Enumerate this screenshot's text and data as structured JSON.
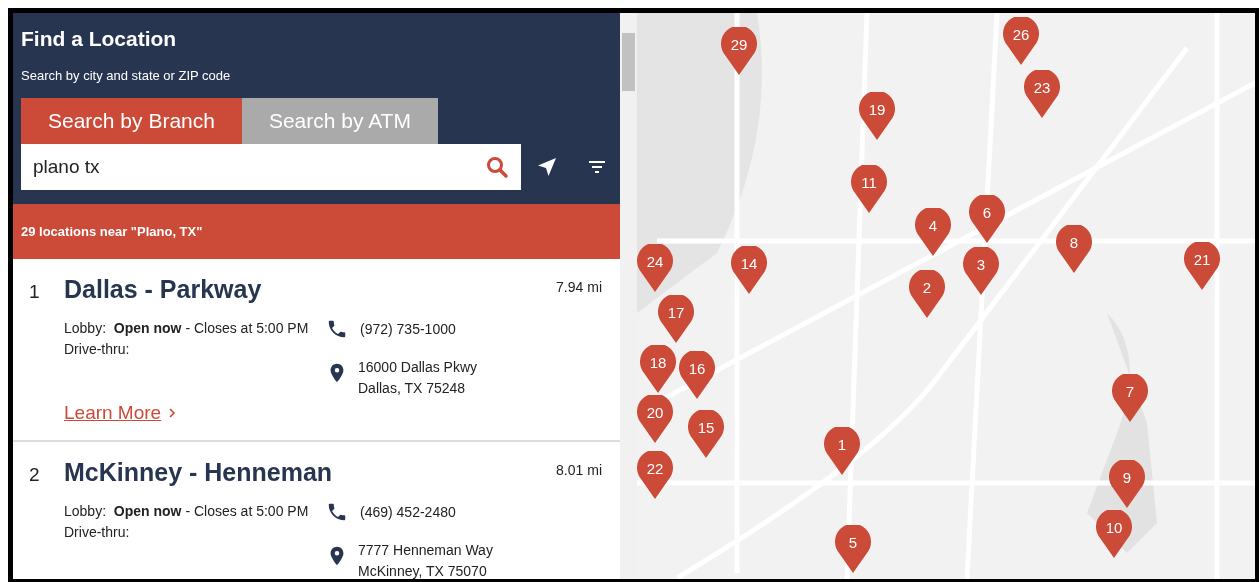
{
  "header": {
    "title": "Find a Location",
    "subtitle": "Search by city and state or ZIP code"
  },
  "tabs": [
    {
      "label": "Search by Branch",
      "selected": true
    },
    {
      "label": "Search by ATM",
      "selected": false
    }
  ],
  "search": {
    "value": "plano tx"
  },
  "results_banner": "29 locations near \"Plano, TX\"",
  "locations": [
    {
      "number": "1",
      "name": "Dallas - Parkway",
      "distance": "7.94 mi",
      "lobby": "Lobby:  **Open now** - Closes at 5:00 PM",
      "drive_thru": "Drive-thru:",
      "phone": "(972) 735-1000",
      "address_lines": [
        "16000 Dallas Pkwy",
        "Dallas, TX 75248"
      ],
      "link": "Learn More"
    },
    {
      "number": "2",
      "name": "McKinney - Henneman",
      "distance": "8.01 mi",
      "lobby": "Lobby:  **Open now** - Closes at 5:00 PM",
      "drive_thru": "Drive-thru:",
      "phone": "(469) 452-2480",
      "address_lines": [
        "7777 Henneman Way",
        "McKinney, TX 75070"
      ]
    }
  ],
  "map": {
    "pins": [
      {
        "label": "26"
      },
      {
        "label": "29"
      },
      {
        "label": "23"
      },
      {
        "label": "19"
      },
      {
        "label": "11"
      },
      {
        "label": "4"
      },
      {
        "label": "6"
      },
      {
        "label": "8"
      },
      {
        "label": "24"
      },
      {
        "label": "14"
      },
      {
        "label": "3"
      },
      {
        "label": "21"
      },
      {
        "label": "2"
      },
      {
        "label": "17"
      },
      {
        "label": "18"
      },
      {
        "label": "16"
      },
      {
        "label": "20"
      },
      {
        "label": "7"
      },
      {
        "label": "15"
      },
      {
        "label": "1"
      },
      {
        "label": "22"
      },
      {
        "label": "9"
      },
      {
        "label": "10"
      },
      {
        "label": "5"
      }
    ]
  }
}
